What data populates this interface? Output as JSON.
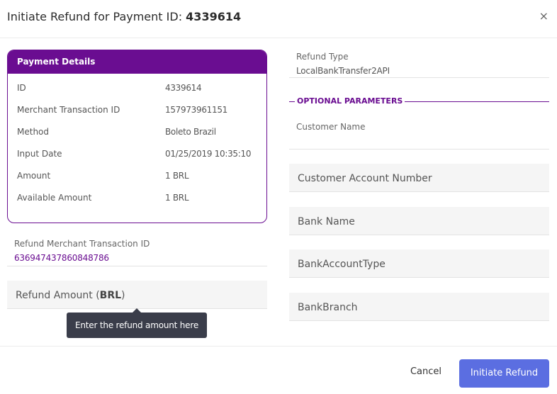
{
  "dialog": {
    "title_prefix": "Initiate Refund for Payment ID: ",
    "payment_id": "4339614",
    "close_glyph": "×"
  },
  "payment_details": {
    "header": "Payment Details",
    "rows": [
      {
        "label": "ID",
        "value": "4339614"
      },
      {
        "label": "Merchant Transaction ID",
        "value": "157973961151"
      },
      {
        "label": "Method",
        "value": "Boleto Brazil"
      },
      {
        "label": "Input Date",
        "value": "01/25/2019 10:35:10"
      },
      {
        "label": "Amount",
        "value": "1 BRL"
      },
      {
        "label": "Available Amount",
        "value": "1 BRL"
      }
    ]
  },
  "refund_merchant_tx": {
    "label": "Refund Merchant Transaction ID",
    "value": "636947437860848786"
  },
  "refund_amount": {
    "placeholder_prefix": "Refund Amount (",
    "currency": "BRL",
    "placeholder_suffix": ")",
    "tooltip": "Enter the refund amount here"
  },
  "refund_type": {
    "label": "Refund Type",
    "value": "LocalBankTransfer2API"
  },
  "optional": {
    "section_title": "OPTIONAL PARAMETERS",
    "customer_name_label": "Customer Name",
    "customer_name_value": "",
    "customer_account_number_placeholder": "Customer Account Number",
    "bank_name_placeholder": "Bank Name",
    "bank_account_type_placeholder": "BankAccountType",
    "bank_branch_placeholder": "BankBranch"
  },
  "footer": {
    "cancel_label": "Cancel",
    "submit_label": "Initiate Refund"
  },
  "colors": {
    "brand_purple": "#6a0d91",
    "primary_button": "#5b6ee1",
    "tooltip_bg": "#3a3d4a"
  }
}
